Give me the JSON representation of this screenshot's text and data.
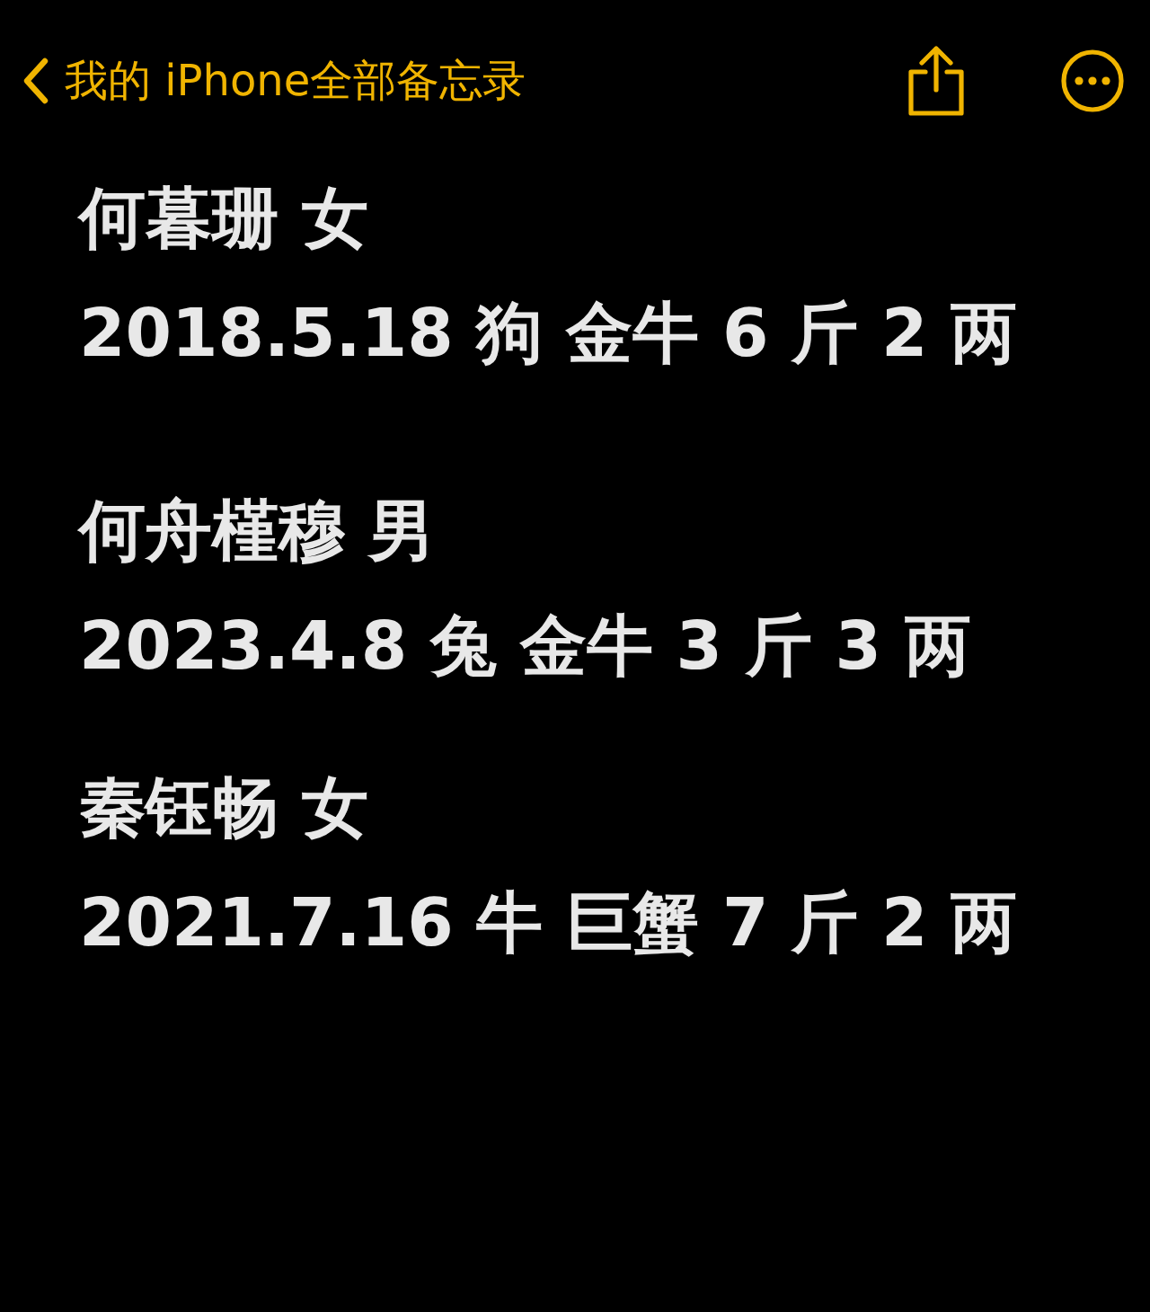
{
  "nav": {
    "back_label": "我的 iPhone全部备忘录"
  },
  "note": {
    "entries": [
      {
        "name_line": "何暮珊 女",
        "detail_line": "2018.5.18 狗 金牛 6 斤 2 两"
      },
      {
        "name_line": "何舟槿穆 男",
        "detail_line": "2023.4.8 兔  金牛 3 斤 3 两"
      },
      {
        "name_line": "秦钰畅 女",
        "detail_line": "2021.7.16 牛 巨蟹 7 斤 2 两"
      }
    ]
  }
}
